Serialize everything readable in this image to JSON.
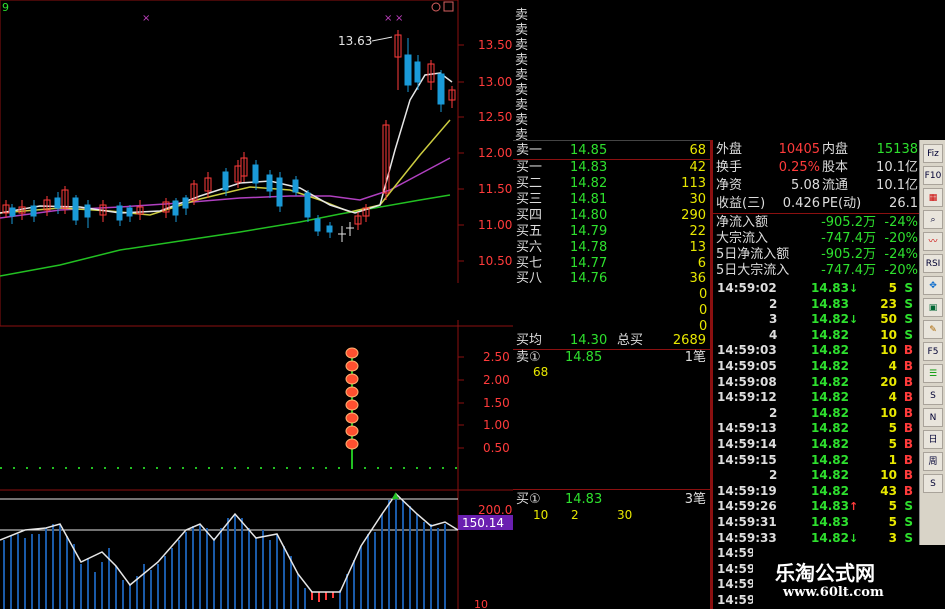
{
  "header": {
    "indicator_corner": "9"
  },
  "main_chart": {
    "high_label": "13.63",
    "y_ticks": [
      "13.50",
      "13.00",
      "12.50",
      "12.00",
      "11.50",
      "11.00",
      "10.50"
    ]
  },
  "volume_panel": {
    "y_ticks": [
      "2.50",
      "2.00",
      "1.50",
      "1.00",
      "0.50"
    ]
  },
  "oscillator_panel": {
    "y_tick": "200.0",
    "current_value": "150.14",
    "bottom_tick": "10"
  },
  "order_book": {
    "top_labels": [
      "卖",
      "卖",
      "卖",
      "卖",
      "卖",
      "卖",
      "卖",
      "卖",
      "卖"
    ],
    "sell1": {
      "label": "卖一",
      "price": "14.85",
      "volume": "68"
    },
    "buys": [
      {
        "label": "买一",
        "price": "14.83",
        "volume": "42"
      },
      {
        "label": "买二",
        "price": "14.82",
        "volume": "113"
      },
      {
        "label": "买三",
        "price": "14.81",
        "volume": "30"
      },
      {
        "label": "买四",
        "price": "14.80",
        "volume": "290"
      },
      {
        "label": "买五",
        "price": "14.79",
        "volume": "22"
      },
      {
        "label": "买六",
        "price": "14.78",
        "volume": "13"
      },
      {
        "label": "买七",
        "price": "14.77",
        "volume": "6"
      },
      {
        "label": "买八",
        "price": "14.76",
        "volume": "36"
      }
    ],
    "right_digits": [
      "0",
      "0",
      "0"
    ],
    "avg_buy": {
      "label": "买均",
      "price": "14.30",
      "total_label": "总买",
      "total": "2689"
    },
    "queue_sell": {
      "label": "卖①",
      "price": "14.85",
      "count": "1笔",
      "volumes": [
        "68"
      ]
    },
    "queue_buy": {
      "label": "买①",
      "price": "14.83",
      "count": "3笔",
      "volumes": [
        "10",
        "2",
        "30"
      ]
    }
  },
  "stats": [
    {
      "l1": "外盘",
      "v1": "10405",
      "l2": "内盘",
      "v2": "15138",
      "v2color": "#2ee02e"
    },
    {
      "l1": "换手",
      "v1": "0.25%",
      "l2": "股本",
      "v2": "10.1亿",
      "v2color": "#ddd"
    },
    {
      "l1": "净资",
      "v1": "5.08",
      "l2": "流通",
      "v2": "10.1亿",
      "v2color": "#ddd"
    },
    {
      "l1": "收益(三)",
      "v1": "0.426",
      "l2": "PE(动)",
      "v2": "26.1",
      "v2color": "#ddd"
    }
  ],
  "flows": [
    {
      "label": "净流入额",
      "value": "-905.2万",
      "pct": "-24%"
    },
    {
      "label": "大宗流入",
      "value": "-747.4万",
      "pct": "-20%"
    },
    {
      "label": "5日净流入额",
      "value": "-905.2万",
      "pct": "-24%"
    },
    {
      "label": "5日大宗流入",
      "value": "-747.4万",
      "pct": "-20%"
    }
  ],
  "ticks": [
    {
      "time": "14:59:02",
      "price": "14.83",
      "arrow": "down",
      "vol": "5",
      "side": "S"
    },
    {
      "time": "2",
      "price": "14.83",
      "arrow": "",
      "vol": "23",
      "side": "S"
    },
    {
      "time": "3",
      "price": "14.82",
      "arrow": "down",
      "vol": "50",
      "side": "S"
    },
    {
      "time": "4",
      "price": "14.82",
      "arrow": "",
      "vol": "10",
      "side": "S"
    },
    {
      "time": "14:59:03",
      "price": "14.82",
      "arrow": "",
      "vol": "10",
      "side": "B"
    },
    {
      "time": "14:59:05",
      "price": "14.82",
      "arrow": "",
      "vol": "4",
      "side": "B"
    },
    {
      "time": "14:59:08",
      "price": "14.82",
      "arrow": "",
      "vol": "20",
      "side": "B"
    },
    {
      "time": "14:59:12",
      "price": "14.82",
      "arrow": "",
      "vol": "4",
      "side": "B"
    },
    {
      "time": "2",
      "price": "14.82",
      "arrow": "",
      "vol": "10",
      "side": "B"
    },
    {
      "time": "14:59:13",
      "price": "14.82",
      "arrow": "",
      "vol": "5",
      "side": "B"
    },
    {
      "time": "14:59:14",
      "price": "14.82",
      "arrow": "",
      "vol": "5",
      "side": "B"
    },
    {
      "time": "14:59:15",
      "price": "14.82",
      "arrow": "",
      "vol": "1",
      "side": "B"
    },
    {
      "time": "2",
      "price": "14.82",
      "arrow": "",
      "vol": "10",
      "side": "B"
    },
    {
      "time": "14:59:19",
      "price": "14.82",
      "arrow": "",
      "vol": "43",
      "side": "B"
    },
    {
      "time": "14:59:26",
      "price": "14.83",
      "arrow": "up",
      "vol": "5",
      "side": "S"
    },
    {
      "time": "14:59:31",
      "price": "14.83",
      "arrow": "",
      "vol": "5",
      "side": "S"
    },
    {
      "time": "14:59:33",
      "price": "14.82",
      "arrow": "down",
      "vol": "3",
      "side": "S"
    },
    {
      "time": "14:59",
      "price": "",
      "arrow": "",
      "vol": "",
      "side": ""
    },
    {
      "time": "14:59",
      "price": "",
      "arrow": "",
      "vol": "",
      "side": ""
    },
    {
      "time": "14:59",
      "price": "",
      "arrow": "",
      "vol": "",
      "side": ""
    },
    {
      "time": "14:59",
      "price": "",
      "arrow": "",
      "vol": "",
      "side": ""
    }
  ],
  "toolbar": [
    "Fiz",
    "F10",
    "RSI",
    "F5",
    "S",
    "N",
    "日",
    "周",
    "S"
  ],
  "watermark": {
    "line1": "乐淘公式网",
    "line2": "www.60lt.com"
  },
  "colors": {
    "up": "#ff3b3b",
    "down": "#2ee02e",
    "volume": "#e8e800",
    "grid": "#8b1010",
    "ma_white": "#e6e6e6",
    "ma_yellow": "#cccc40",
    "ma_purple": "#b040c0",
    "ma_green": "#22c022"
  }
}
